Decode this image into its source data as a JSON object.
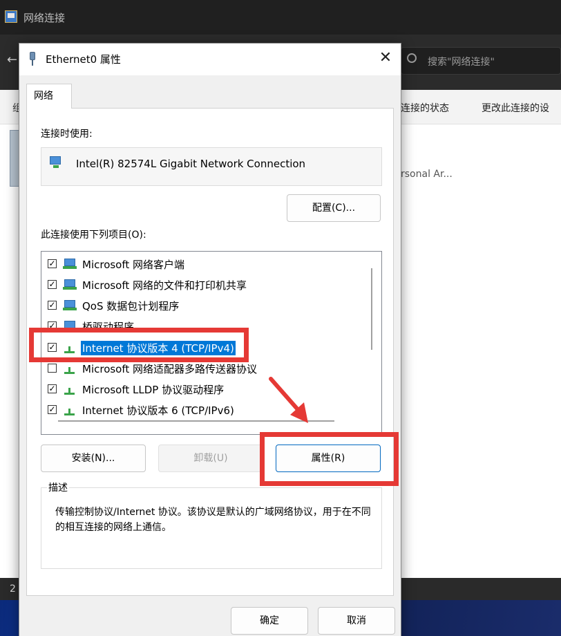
{
  "background_window": {
    "title": "网络连接",
    "search_placeholder": "搜索\"网络连接\"",
    "cmd_left": "组",
    "cmd_status": "连接的状态",
    "cmd_change": "更改此连接的设",
    "item_text": "rsonal Ar...",
    "status_text": "2"
  },
  "dialog": {
    "title": "Ethernet0 属性",
    "tab": "网络",
    "connect_using_label": "连接时使用:",
    "adapter_name": "Intel(R) 82574L Gigabit Network Connection",
    "configure_button": "配置(C)...",
    "items_label": "此连接使用下列项目(O):",
    "items": [
      {
        "label": "Microsoft 网络客户端",
        "checked": true,
        "icon": "client-icon"
      },
      {
        "label": "Microsoft 网络的文件和打印机共享",
        "checked": true,
        "icon": "client-icon"
      },
      {
        "label": "QoS 数据包计划程序",
        "checked": true,
        "icon": "client-icon"
      },
      {
        "label": "桥驱动程序",
        "checked": true,
        "icon": "client-icon"
      },
      {
        "label": "Internet 协议版本 4 (TCP/IPv4)",
        "checked": true,
        "icon": "protocol-icon",
        "selected": true
      },
      {
        "label": "Microsoft 网络适配器多路传送器协议",
        "checked": false,
        "icon": "protocol-icon"
      },
      {
        "label": "Microsoft LLDP 协议驱动程序",
        "checked": true,
        "icon": "protocol-icon"
      },
      {
        "label": "Internet 协议版本 6 (TCP/IPv6)",
        "checked": true,
        "icon": "protocol-icon"
      }
    ],
    "install_button": "安装(N)...",
    "uninstall_button": "卸载(U)",
    "properties_button": "属性(R)",
    "description_title": "描述",
    "description_text": "传输控制协议/Internet 协议。该协议是默认的广域网络协议，用于在不同的相互连接的网络上通信。",
    "ok_button": "确定",
    "cancel_button": "取消",
    "close_glyph": "✕"
  },
  "annotation": {
    "color": "#e53935"
  }
}
